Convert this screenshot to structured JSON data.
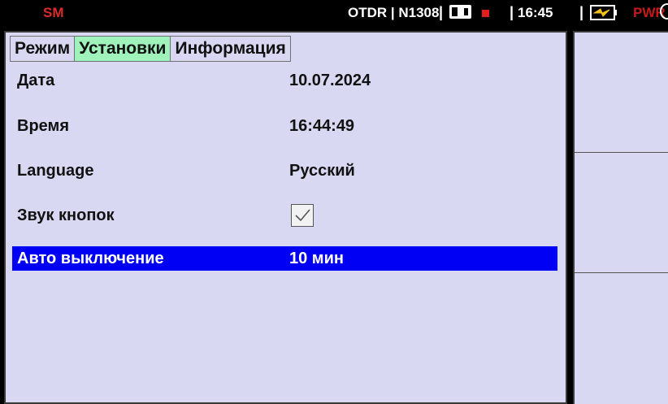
{
  "status_bar": {
    "mode": "SM",
    "device": "OTDR | N1308",
    "separator": "|",
    "time": "16:45",
    "pwr": "PWR",
    "icons": [
      "sd-card-icon",
      "record-indicator-icon",
      "battery-charging-icon",
      "power-circle-icon"
    ]
  },
  "tabs": [
    {
      "label": "Режим",
      "active": false
    },
    {
      "label": "Установки",
      "active": true
    },
    {
      "label": "Информация",
      "active": false
    }
  ],
  "settings": {
    "date": {
      "label": "Дата",
      "value": "10.07.2024"
    },
    "time": {
      "label": "Время",
      "value": "16:44:49"
    },
    "language": {
      "label": "Language",
      "value": "Русский"
    },
    "key_sound": {
      "label": "Звук кнопок",
      "checked": true
    },
    "auto_off": {
      "label": "Авто выключение",
      "value": "10 мин",
      "selected": true
    }
  },
  "colors": {
    "panel_bg": "#d8d8f2",
    "active_tab": "#9ff2ba",
    "selection": "#0000f5",
    "mode_red": "#d92b2b"
  }
}
